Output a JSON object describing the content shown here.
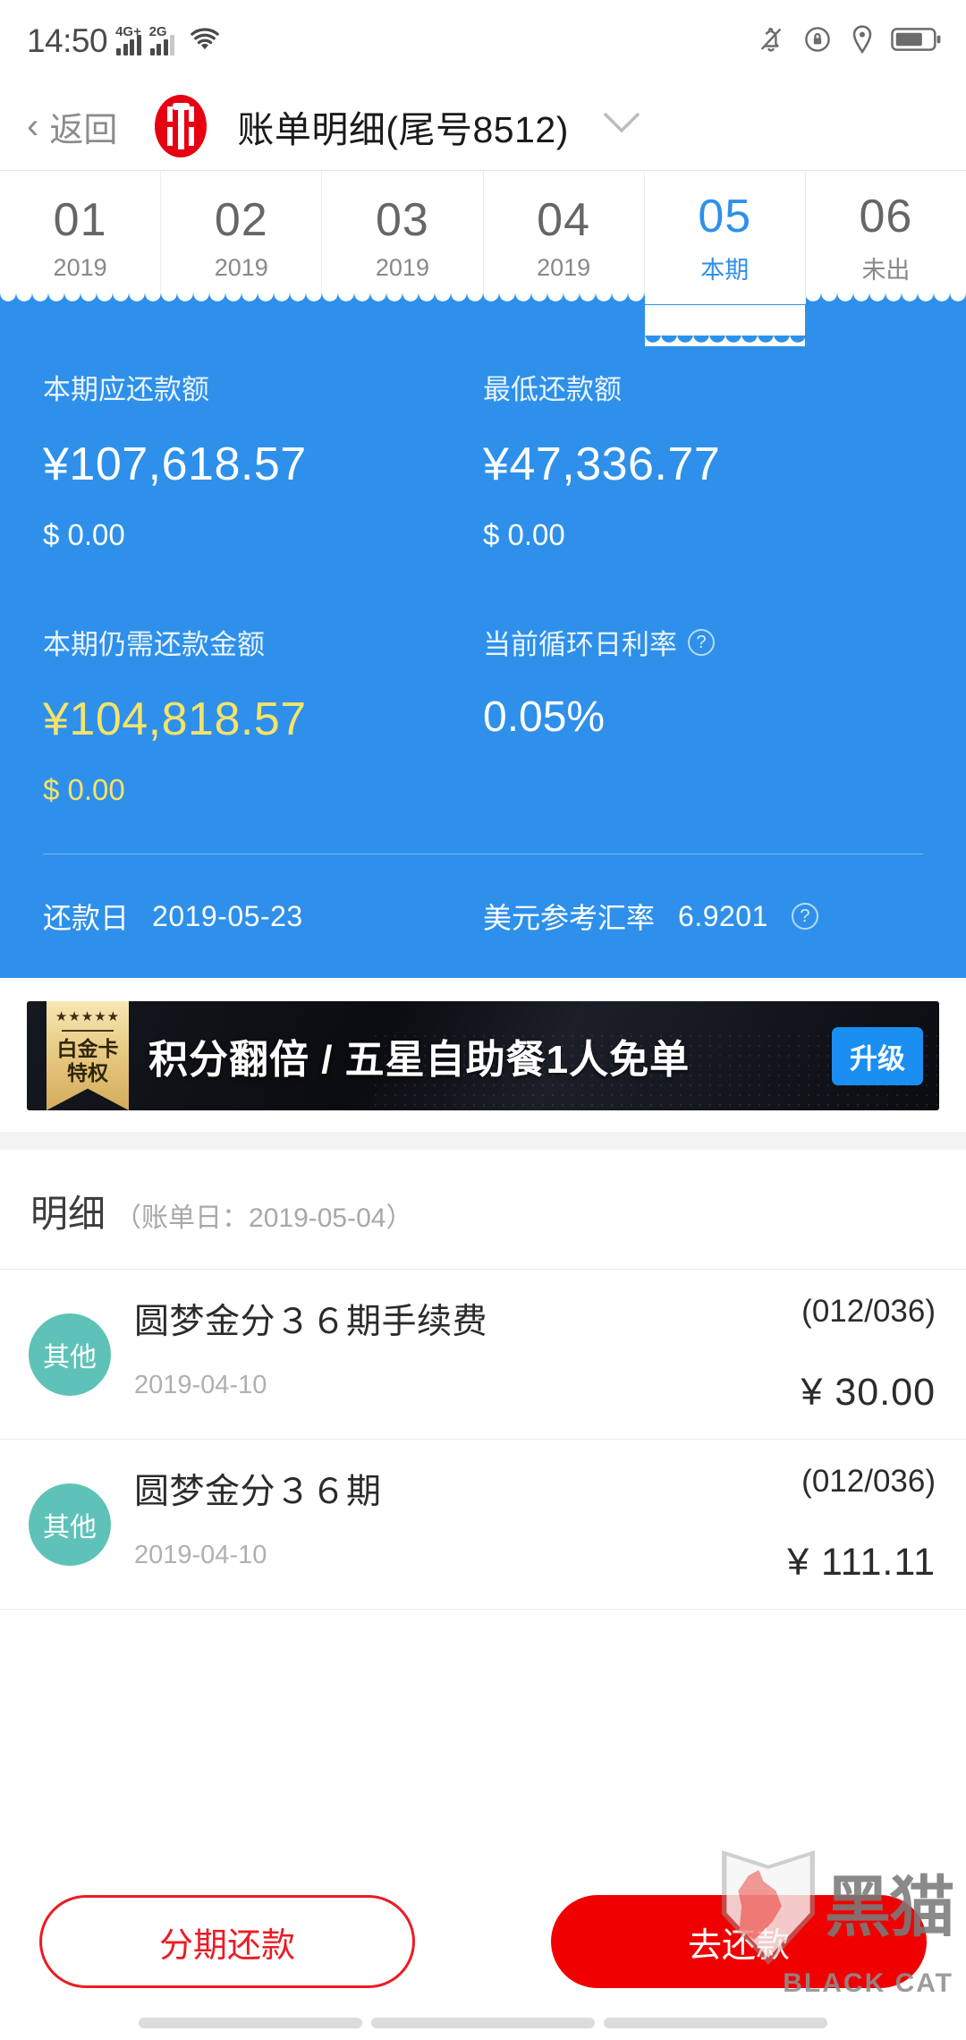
{
  "status_bar": {
    "time": "14:50",
    "net_primary": "4G+",
    "net_secondary": "2G",
    "icons": [
      "wifi-icon",
      "bell-off-icon",
      "rotation-lock-icon",
      "location-icon",
      "battery-icon"
    ]
  },
  "header": {
    "back_label": "返回",
    "bank_logo": "citic-logo",
    "title": "账单明细(尾号8512)",
    "caret": "⌄"
  },
  "month_tabs": [
    {
      "month": "01",
      "sub": "2019",
      "active": false
    },
    {
      "month": "02",
      "sub": "2019",
      "active": false
    },
    {
      "month": "03",
      "sub": "2019",
      "active": false
    },
    {
      "month": "04",
      "sub": "2019",
      "active": false
    },
    {
      "month": "05",
      "sub": "本期",
      "active": true
    },
    {
      "month": "06",
      "sub": "未出",
      "active": false
    }
  ],
  "summary": {
    "accent_color": "#2e90ea",
    "highlight_color": "#f6e36a",
    "due_label": "本期应还款额",
    "due_cny": "¥107,618.57",
    "due_usd": "$ 0.00",
    "min_label": "最低还款额",
    "min_cny": "¥47,336.77",
    "min_usd": "$ 0.00",
    "remaining_label": "本期仍需还款金额",
    "remaining_cny": "¥104,818.57",
    "remaining_usd": "$ 0.00",
    "rate_label": "当前循环日利率",
    "rate_value": "0.05%",
    "repay_date_label": "还款日",
    "repay_date_value": "2019-05-23",
    "fx_label": "美元参考汇率",
    "fx_value": "6.9201"
  },
  "promo": {
    "badge_stars": "★★★★★",
    "badge_line1": "白金卡",
    "badge_line2": "特权",
    "title": "积分翻倍 / 五星自助餐1人免单",
    "button": "升级",
    "button_color": "#1b8ef2"
  },
  "detail": {
    "title": "明细",
    "subtitle": "（账单日：2019-05-04）",
    "badge_color": "#5ec2b8",
    "rows": [
      {
        "category": "其他",
        "name": "圆梦金分３６期手续费",
        "installment": "(012/036)",
        "date": "2019-04-10",
        "amount": "¥ 30.00"
      },
      {
        "category": "其他",
        "name": "圆梦金分３６期",
        "installment": "(012/036)",
        "date": "2019-04-10",
        "amount": "¥ 111.11"
      }
    ]
  },
  "actions": {
    "secondary_label": "分期还款",
    "primary_label": "去还款",
    "primary_color": "#f00000",
    "secondary_color": "#ed1b23"
  },
  "watermark": {
    "text_cn": "黑猫",
    "text_en": "BLACK CAT"
  }
}
